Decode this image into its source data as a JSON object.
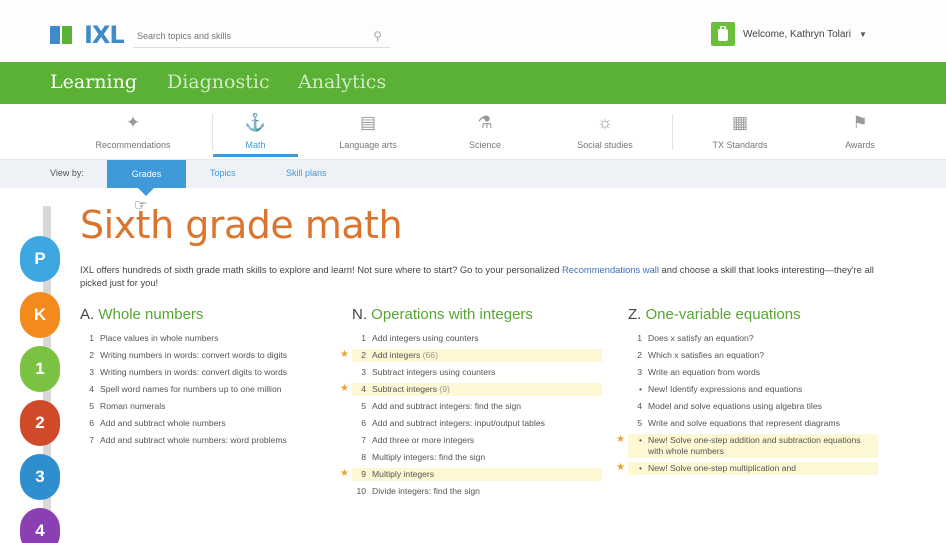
{
  "header": {
    "logo": "IXL",
    "search_placeholder": "Search topics and skills",
    "welcome": "Welcome, Kathryn Tolari",
    "caret": "▼"
  },
  "main_nav": {
    "tabs": [
      {
        "label": "Learning",
        "active": true
      },
      {
        "label": "Diagnostic",
        "active": false
      },
      {
        "label": "Analytics",
        "active": false
      }
    ]
  },
  "subjects": [
    {
      "label": "Recommendations",
      "icon": "sparkle-icon",
      "active": false
    },
    {
      "label": "Math",
      "icon": "compass-icon",
      "active": true
    },
    {
      "label": "Language arts",
      "icon": "book-icon",
      "active": false
    },
    {
      "label": "Science",
      "icon": "flask-icon",
      "active": false
    },
    {
      "label": "Social studies",
      "icon": "globe-icon",
      "active": false
    },
    {
      "label": "TX Standards",
      "icon": "clipboard-icon",
      "active": false
    },
    {
      "label": "Awards",
      "icon": "trophy-icon",
      "active": false
    }
  ],
  "viewby": {
    "label": "View by:",
    "options": [
      "Grades",
      "Topics",
      "Skill plans"
    ],
    "selected": "Grades"
  },
  "grades": [
    {
      "label": "P",
      "color": "#3da8e0"
    },
    {
      "label": "K",
      "color": "#f28b1c"
    },
    {
      "label": "1",
      "color": "#7cc242"
    },
    {
      "label": "2",
      "color": "#d04a2a"
    },
    {
      "label": "3",
      "color": "#2f8fce"
    },
    {
      "label": "4",
      "color": "#8a3fb2"
    }
  ],
  "page": {
    "title": "Sixth grade math",
    "intro_before": "IXL offers hundreds of sixth grade math skills to explore and learn! Not sure where to start? Go to your personalized ",
    "intro_link": "Recommendations wall",
    "intro_after": " and choose a skill that looks interesting—they're all picked just for you!"
  },
  "columns": [
    {
      "letter": "A.",
      "name": "Whole numbers",
      "items": [
        {
          "num": "1",
          "text": "Place values in whole numbers"
        },
        {
          "num": "2",
          "text": "Writing numbers in words: convert words to digits"
        },
        {
          "num": "3",
          "text": "Writing numbers in words: convert digits to words"
        },
        {
          "num": "4",
          "text": "Spell word names for numbers up to one million"
        },
        {
          "num": "5",
          "text": "Roman numerals"
        },
        {
          "num": "6",
          "text": "Add and subtract whole numbers"
        },
        {
          "num": "7",
          "text": "Add and subtract whole numbers: word problems"
        }
      ]
    },
    {
      "letter": "N.",
      "name": "Operations with integers",
      "items": [
        {
          "num": "1",
          "text": "Add integers using counters"
        },
        {
          "num": "2",
          "text": "Add integers",
          "count": "(66)",
          "star": true
        },
        {
          "num": "3",
          "text": "Subtract integers using counters"
        },
        {
          "num": "4",
          "text": "Subtract integers",
          "count": "(9)",
          "star": true
        },
        {
          "num": "5",
          "text": "Add and subtract integers: find the sign"
        },
        {
          "num": "6",
          "text": "Add and subtract integers: input/output tables"
        },
        {
          "num": "7",
          "text": "Add three or more integers"
        },
        {
          "num": "8",
          "text": "Multiply integers: find the sign"
        },
        {
          "num": "9",
          "text": "Multiply integers",
          "star": true
        },
        {
          "num": "10",
          "text": "Divide integers: find the sign"
        }
      ]
    },
    {
      "letter": "Z.",
      "name": "One-variable equations",
      "items": [
        {
          "num": "1",
          "text": "Does x satisfy an equation?"
        },
        {
          "num": "2",
          "text": "Which x satisfies an equation?"
        },
        {
          "num": "3",
          "text": "Write an equation from words"
        },
        {
          "num": "•",
          "text": "New! Identify expressions and equations"
        },
        {
          "num": "4",
          "text": "Model and solve equations using algebra tiles"
        },
        {
          "num": "5",
          "text": "Write and solve equations that represent diagrams"
        },
        {
          "num": "•",
          "text": "New! Solve one-step addition and subtraction equations with whole numbers",
          "star": true
        },
        {
          "num": "•",
          "text": "New! Solve one-step multiplication and",
          "star": true
        }
      ]
    }
  ]
}
